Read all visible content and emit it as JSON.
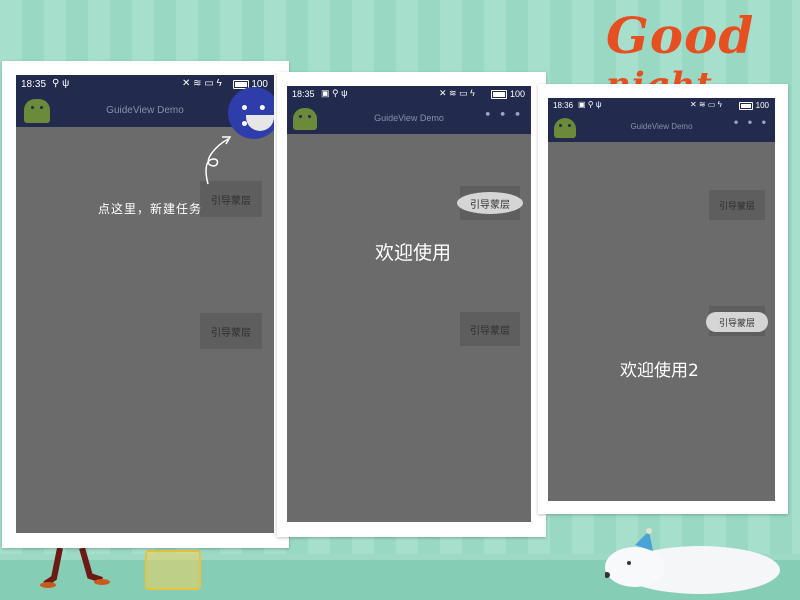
{
  "background": {
    "colors": [
      "#a6e0cd",
      "#99d9c4"
    ]
  },
  "decoration": {
    "title_part1": "Good",
    "title_part2": "night",
    "color": "#e65021"
  },
  "screens": [
    {
      "status": {
        "time": "18:35",
        "battery": "100"
      },
      "app_title": "GuideView Demo",
      "menu_icon": "overflow-menu-icon",
      "buttons": [
        "引导蒙层",
        "引导蒙层"
      ],
      "hint": "点这里，新建任务"
    },
    {
      "status": {
        "time": "18:35",
        "battery": "100"
      },
      "app_title": "GuideView Demo",
      "menu_icon": "overflow-menu-icon",
      "buttons": [
        "引导蒙层",
        "引导蒙层"
      ],
      "welcome": "欢迎使用"
    },
    {
      "status": {
        "time": "18:36",
        "battery": "100"
      },
      "app_title": "GuideView Demo",
      "menu_icon": "overflow-menu-icon",
      "buttons": [
        "引导蒙层",
        "引导蒙层"
      ],
      "welcome": "欢迎使用2"
    }
  ]
}
